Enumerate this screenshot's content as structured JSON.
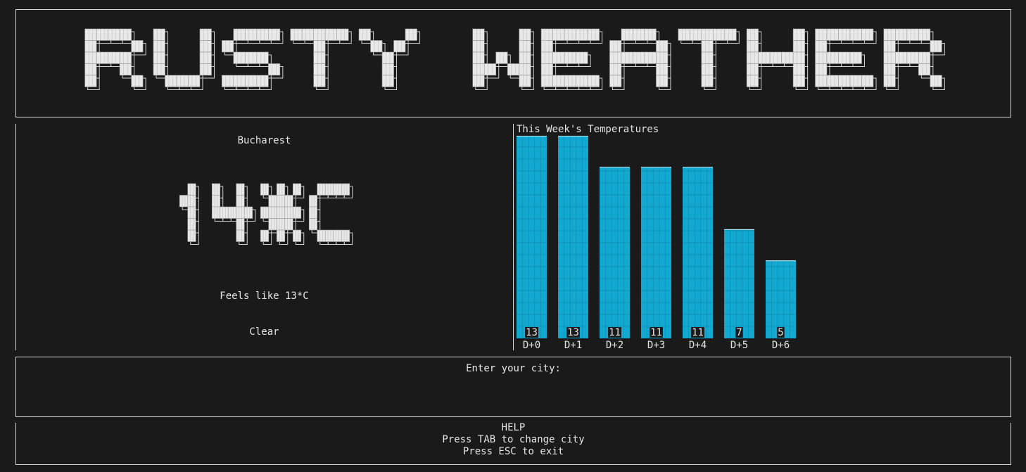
{
  "app": {
    "title": "RUSTY WEATHER"
  },
  "current": {
    "city": "Bucharest",
    "temperature": "14*C",
    "feels_like": "Feels like 13*C",
    "condition": "Clear"
  },
  "chart_data": {
    "type": "bar",
    "title": "This Week's Temperatures",
    "categories": [
      "D+0",
      "D+1",
      "D+2",
      "D+3",
      "D+4",
      "D+5",
      "D+6"
    ],
    "values": [
      13,
      13,
      11,
      11,
      11,
      7,
      5
    ],
    "ylim": [
      0,
      13
    ],
    "bar_color": "#12a8d0"
  },
  "input": {
    "prompt": "Enter your city:",
    "value": ""
  },
  "help": {
    "heading": "HELP",
    "line1": "Press TAB to change city",
    "line2": "Press ESC to exit"
  },
  "colors": {
    "background": "#1a1a1a",
    "border": "#d8d8d8",
    "foreground": "#e6e6e6",
    "bar": "#12a8d0"
  }
}
